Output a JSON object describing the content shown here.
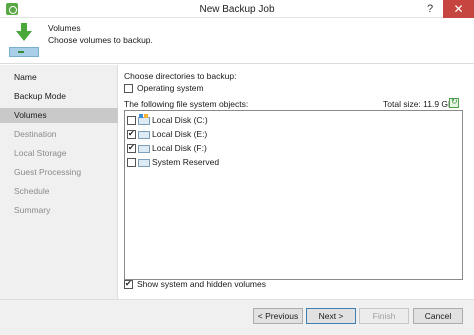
{
  "window": {
    "title": "New Backup Job",
    "help_glyph": "?",
    "close_glyph": "✕"
  },
  "header": {
    "title": "Volumes",
    "description": "Choose volumes to backup."
  },
  "sidebar": {
    "items": [
      {
        "label": "Name"
      },
      {
        "label": "Backup Mode"
      },
      {
        "label": "Volumes"
      },
      {
        "label": "Destination"
      },
      {
        "label": "Local Storage"
      },
      {
        "label": "Guest Processing"
      },
      {
        "label": "Schedule"
      },
      {
        "label": "Summary"
      }
    ]
  },
  "main": {
    "directories_label": "Choose directories to backup:",
    "operating_system": {
      "label": "Operating system",
      "checked": false
    },
    "objects_label": "The following file system objects:",
    "total_size": "Total size:  11.9 GB",
    "volumes": [
      {
        "name": "Local Disk (C:)",
        "checked": false
      },
      {
        "name": "Local Disk (E:)",
        "checked": true
      },
      {
        "name": "Local Disk (F:)",
        "checked": true
      },
      {
        "name": "System Reserved",
        "checked": false
      }
    ],
    "show_hidden": {
      "label": "Show system and hidden volumes",
      "checked": true
    }
  },
  "footer": {
    "previous": "< Previous",
    "next": "Next >",
    "finish": "Finish",
    "cancel": "Cancel"
  },
  "colors": {
    "accent_green": "#5aa845",
    "close_red": "#c74541"
  }
}
